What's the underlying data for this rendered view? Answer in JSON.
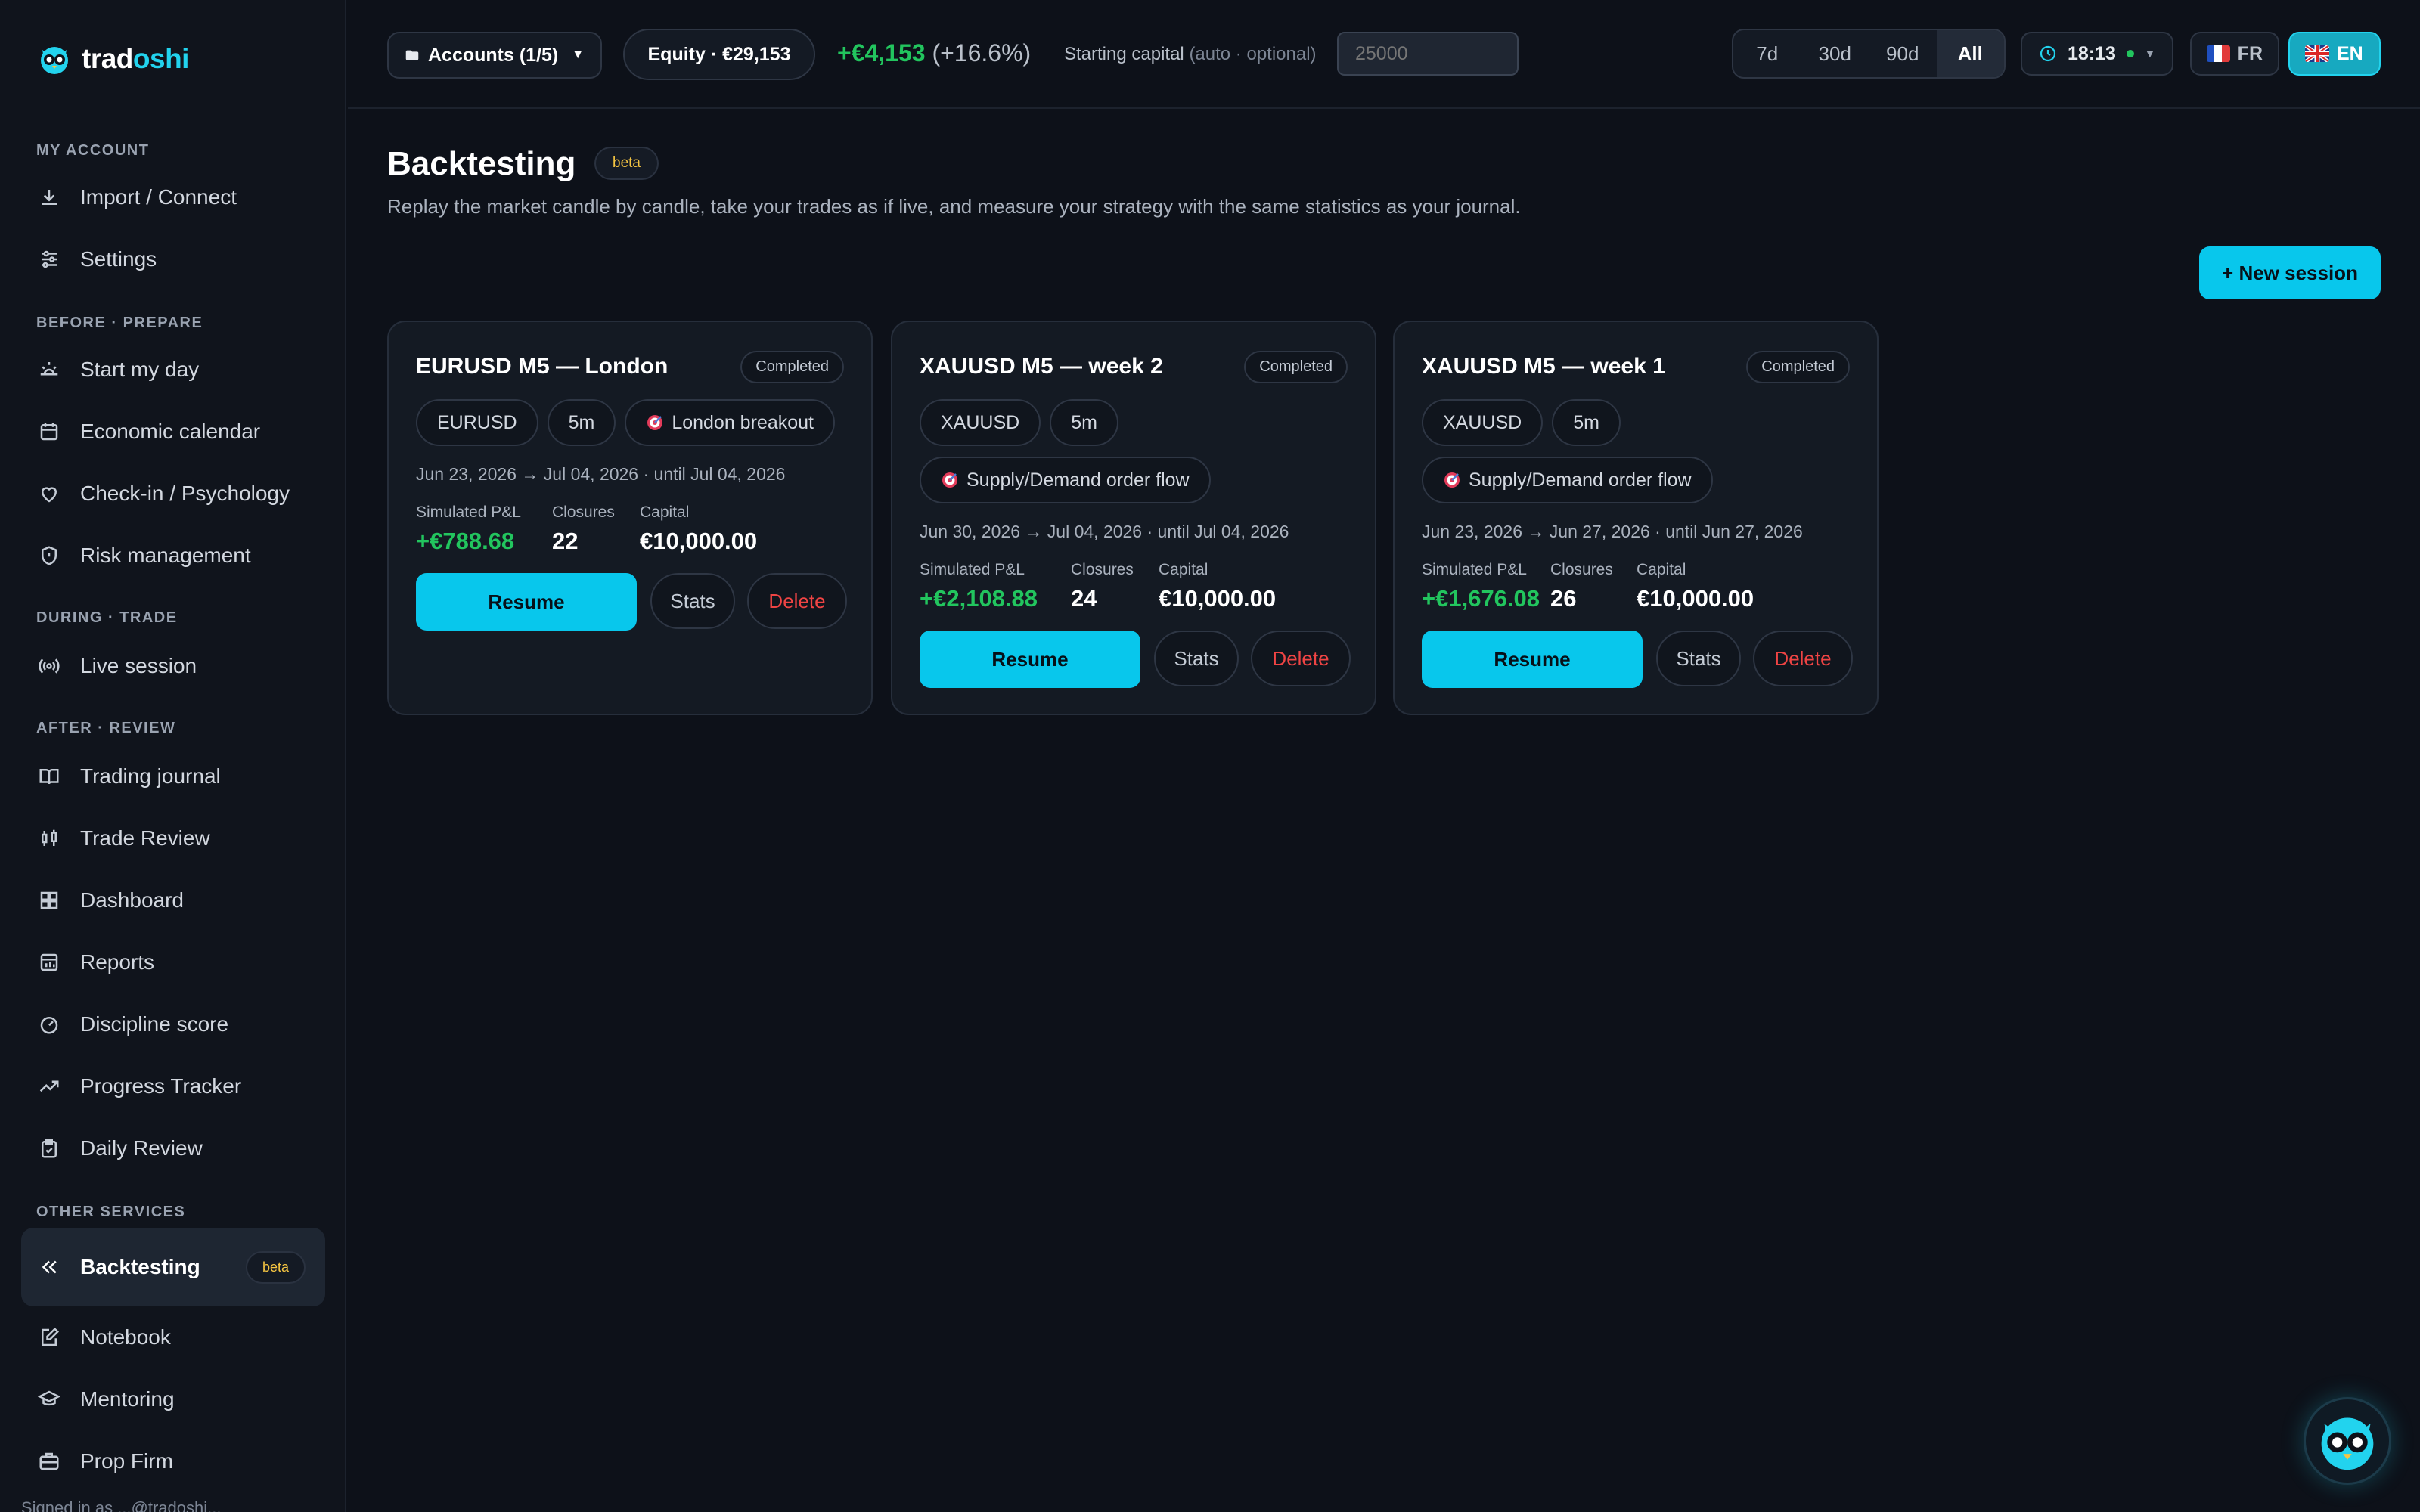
{
  "app": {
    "logo_part1": "trad",
    "logo_part2": "oshi"
  },
  "sidebar": {
    "sections": [
      {
        "label": "MY ACCOUNT"
      },
      {
        "label": "BEFORE · PREPARE"
      },
      {
        "label": "DURING · TRADE"
      },
      {
        "label": "AFTER · REVIEW"
      },
      {
        "label": "OTHER SERVICES"
      }
    ],
    "items": [
      {
        "label": "Import / Connect",
        "icon": "download-icon"
      },
      {
        "label": "Settings",
        "icon": "sliders-icon"
      },
      {
        "label": "Start my day",
        "icon": "sunrise-icon"
      },
      {
        "label": "Economic calendar",
        "icon": "calendar-icon"
      },
      {
        "label": "Check-in / Psychology",
        "icon": "heart-icon"
      },
      {
        "label": "Risk management",
        "icon": "shield-icon"
      },
      {
        "label": "Live session",
        "icon": "broadcast-icon"
      },
      {
        "label": "Trading journal",
        "icon": "book-icon"
      },
      {
        "label": "Trade Review",
        "icon": "candlestick-icon"
      },
      {
        "label": "Dashboard",
        "icon": "grid-icon"
      },
      {
        "label": "Reports",
        "icon": "report-icon"
      },
      {
        "label": "Discipline score",
        "icon": "gauge-icon"
      },
      {
        "label": "Progress Tracker",
        "icon": "trend-icon"
      },
      {
        "label": "Daily Review",
        "icon": "clipboard-check-icon"
      },
      {
        "label": "Backtesting",
        "icon": "rewind-icon",
        "badge": "beta",
        "active": true
      },
      {
        "label": "Notebook",
        "icon": "notebook-icon"
      },
      {
        "label": "Mentoring",
        "icon": "graduation-icon"
      },
      {
        "label": "Prop Firm",
        "icon": "briefcase-icon"
      }
    ],
    "footer_text": "Signed in as ...@tradoshi..."
  },
  "topbar": {
    "accounts_label": "Accounts (1/5)",
    "equity_label": "Equity · €29,153",
    "pnl_value": "+€4,153",
    "pnl_percent": "(+16.6%)",
    "starting_capital_label": "Starting capital",
    "starting_capital_hint": "(auto · optional)",
    "starting_capital_placeholder": "25000",
    "ranges": [
      "7d",
      "30d",
      "90d",
      "All"
    ],
    "selected_range": "All",
    "time": "18:13",
    "lang_fr": "FR",
    "lang_en": "EN",
    "selected_lang": "EN"
  },
  "page": {
    "title": "Backtesting",
    "title_badge": "beta",
    "subtitle": "Replay the market candle by candle, take your trades as if live, and measure your strategy with the same statistics as your journal.",
    "new_session_label": "+ New session"
  },
  "sessions": [
    {
      "title": "EURUSD M5 — London",
      "status": "Completed",
      "chips": [
        "EURUSD",
        "5m"
      ],
      "strategy": "London breakout",
      "range": "Jun 23, 2026 → Jul 04, 2026 · until Jul 04, 2026",
      "pnl_label": "Simulated P&L",
      "pnl": "+€788.68",
      "closures_label": "Closures",
      "closures": "22",
      "capital_label": "Capital",
      "capital": "€10,000.00",
      "resume_label": "Resume",
      "stats_label": "Stats",
      "delete_label": "Delete"
    },
    {
      "title": "XAUUSD M5 — week 2",
      "status": "Completed",
      "chips": [
        "XAUUSD",
        "5m"
      ],
      "strategy": "Supply/Demand order flow",
      "range": "Jun 30, 2026 → Jul 04, 2026 · until Jul 04, 2026",
      "pnl_label": "Simulated P&L",
      "pnl": "+€2,108.88",
      "closures_label": "Closures",
      "closures": "24",
      "capital_label": "Capital",
      "capital": "€10,000.00",
      "resume_label": "Resume",
      "stats_label": "Stats",
      "delete_label": "Delete"
    },
    {
      "title": "XAUUSD M5 — week 1",
      "status": "Completed",
      "chips": [
        "XAUUSD",
        "5m"
      ],
      "strategy": "Supply/Demand order flow",
      "range": "Jun 23, 2026 → Jun 27, 2026 · until Jun 27, 2026",
      "pnl_label": "Simulated P&L",
      "pnl": "+€1,676.08",
      "closures_label": "Closures",
      "closures": "26",
      "capital_label": "Capital",
      "capital": "€10,000.00",
      "resume_label": "Resume",
      "stats_label": "Stats",
      "delete_label": "Delete"
    }
  ],
  "colors": {
    "accent": "#08c7ec",
    "positive": "#22c55e",
    "danger": "#ef4444",
    "beta": "#f5c542"
  }
}
